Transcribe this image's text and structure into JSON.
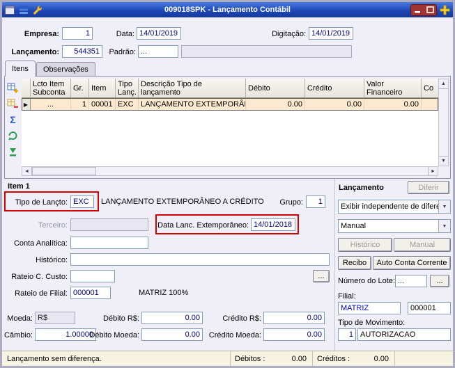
{
  "window": {
    "title": "009018SPK - Lançamento Contábil"
  },
  "icons": {
    "row_marker": "▶",
    "sigma": "Σ",
    "dropdown_arrow": "▼",
    "scroll_up": "▲",
    "scroll_down": "▼",
    "scroll_left": "◄",
    "scroll_right": "►"
  },
  "colors": {
    "titlebar_blue": "#1e48b8",
    "selected_row": "#fce9d0",
    "annotation_red": "#d40000",
    "value_navy": "#000080"
  },
  "top_form": {
    "empresa_label": "Empresa:",
    "empresa_value": "1",
    "data_label": "Data:",
    "data_value": "14/01/2019",
    "digitacao_label": "Digitação:",
    "digitacao_value": "14/01/2019",
    "lancamento_label": "Lançamento:",
    "lancamento_value": "544351",
    "padrao_label": "Padrão:",
    "padrao_value": "...",
    "padrao_desc": ""
  },
  "tabs": {
    "itens": "Itens",
    "observacoes": "Observações"
  },
  "grid": {
    "headers": [
      "Lcto Item Subconta",
      "Gr.",
      "Item",
      "Tipo Lanç.",
      "Descrição Tipo de lançamento",
      "Débito",
      "Crédito",
      "Valor Financeiro",
      "Co"
    ],
    "row": {
      "lcto_item_subconta": "...",
      "gr": "1",
      "item": "00001",
      "tipo_lanc": "EXC",
      "descricao": "LANÇAMENTO EXTEMPORÂNE",
      "debito": "0.00",
      "credito": "0.00",
      "valor_financeiro": "0.00",
      "co": ""
    }
  },
  "item": {
    "title": "Item 1",
    "tipo_lancto_label": "Tipo de Lançto:",
    "tipo_lancto_value": "EXC",
    "tipo_lancto_desc": "LANÇAMENTO EXTEMPORÂNEO A CRÉDITO",
    "grupo_label": "Grupo:",
    "grupo_value": "1",
    "terceiro_label": "Terceiro:",
    "terceiro_value": "",
    "data_ext_label": "Data Lanc. Extemporâneo:",
    "data_ext_value": "14/01/2018",
    "conta_analitica_label": "Conta Analítica:",
    "conta_analitica_value": "",
    "historico_label": "Histórico:",
    "historico_value": "",
    "rateio_custo_label": "Rateio C. Custo:",
    "rateio_custo_value": "",
    "rateio_custo_button": "...",
    "rateio_filial_label": "Rateio de Filial:",
    "rateio_filial_value": "000001",
    "rateio_filial_desc": "MATRIZ 100%",
    "moeda_label": "Moeda:",
    "moeda_value": "R$",
    "debito_rs_label": "Débito R$:",
    "debito_rs_value": "0.00",
    "credito_rs_label": "Crédito R$:",
    "credito_rs_value": "0.00",
    "cambio_label": "Câmbio:",
    "cambio_value": "1.00000",
    "debito_moeda_label": "Débito Moeda:",
    "debito_moeda_value": "0.00",
    "credito_moeda_label": "Crédito Moeda:",
    "credito_moeda_value": "0.00"
  },
  "lancamento_panel": {
    "title": "Lançamento",
    "diferir_button": "Diferir",
    "exibir_select": "Exibir independente de difere",
    "manual_select": "Manual",
    "historico_button": "Histórico",
    "manual_button": "Manual",
    "recibo_button": "Recibo",
    "auto_conta_button": "Auto Conta Corrente",
    "numero_lote_label": "Número do Lote:",
    "numero_lote_value": "...",
    "numero_lote_browse": "...",
    "filial_label": "Filial:",
    "filial_value": "MATRIZ",
    "filial_code": "000001",
    "tipo_movimento_label": "Tipo de Movimento:",
    "tipo_movimento_code": "1",
    "tipo_movimento_value": "AUTORIZACAO"
  },
  "status_bar": {
    "message": "Lançamento sem diferença.",
    "debitos_label": "Débitos :",
    "debitos_value": "0.00",
    "creditos_label": "Créditos :",
    "creditos_value": "0.00"
  }
}
